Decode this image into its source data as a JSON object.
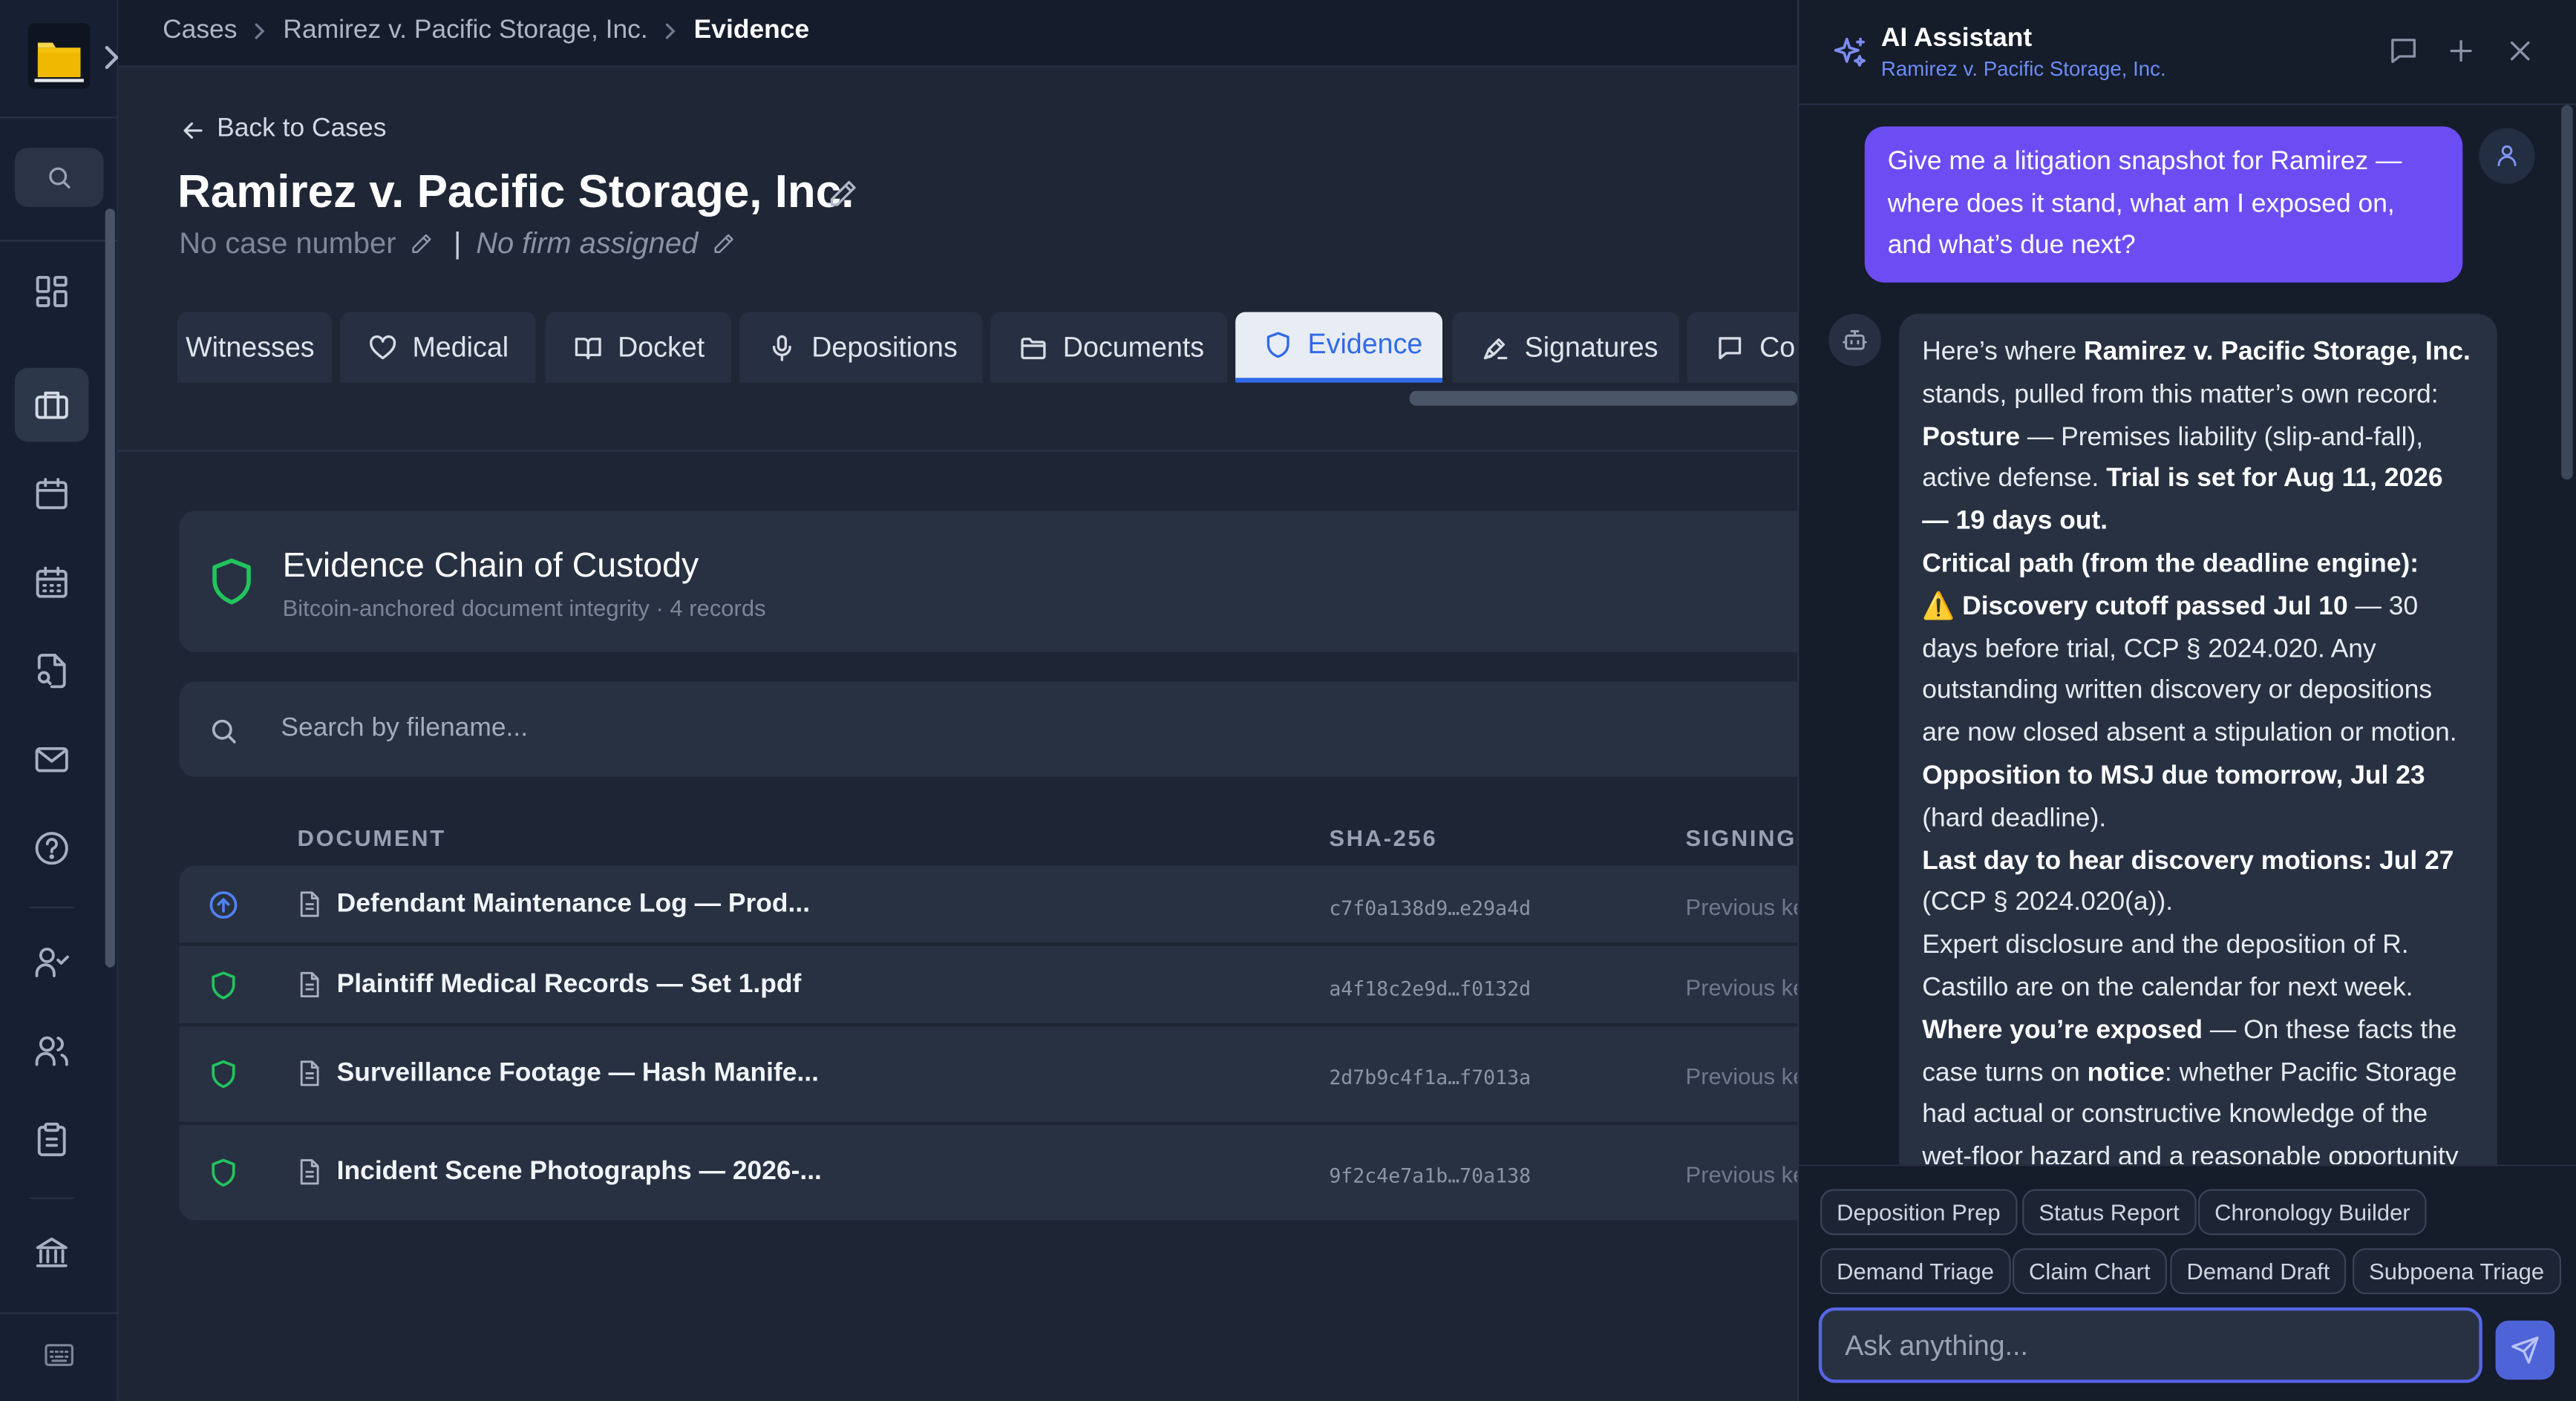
{
  "colors": {
    "accent": "#2f6bea",
    "verified_green": "#21c45d",
    "user_bubble": "#6c4df4",
    "ai_link": "#6b8df7",
    "background": "#1e2534"
  },
  "breadcrumb": {
    "items": [
      "Cases",
      "Ramirez v. Pacific Storage, Inc."
    ],
    "current": "Evidence"
  },
  "rail": {
    "icons": [
      "grid-icon",
      "briefcase-icon",
      "calendar-icon",
      "calendar-days-icon",
      "file-search-icon",
      "mail-icon",
      "help-icon",
      "user-check-icon",
      "users-icon",
      "clipboard-icon",
      "courthouse-icon",
      "keyboard-icon"
    ]
  },
  "case": {
    "back_label": "Back to Cases",
    "title": "Ramirez v. Pacific Storage, Inc.",
    "case_number": "No case number",
    "separator": "|",
    "firm": "No firm assigned"
  },
  "tabs": [
    {
      "label": "Witnesses",
      "icon": "none"
    },
    {
      "label": "Medical",
      "icon": "heart-icon"
    },
    {
      "label": "Docket",
      "icon": "book-icon"
    },
    {
      "label": "Depositions",
      "icon": "mic-icon"
    },
    {
      "label": "Documents",
      "icon": "folder-icon"
    },
    {
      "label": "Evidence",
      "icon": "shield-icon",
      "active": true
    },
    {
      "label": "Signatures",
      "icon": "signature-icon"
    },
    {
      "label": "Co",
      "icon": "message-icon"
    }
  ],
  "evidence": {
    "title": "Evidence Chain of Custody",
    "subtitle": "Bitcoin-anchored document integrity · 4 records",
    "search_placeholder": "Search by filename..."
  },
  "table": {
    "headers": {
      "document": "DOCUMENT",
      "sha": "SHA-256",
      "signing": "SIGNING K"
    },
    "rows": [
      {
        "status": "upload-pending-icon",
        "filename": "Defendant Maintenance Log — Prod...",
        "hash": "c7f0a138d9…e29a4d",
        "signer": "Previous key"
      },
      {
        "status": "verified-shield-icon",
        "filename": "Plaintiff Medical Records — Set 1.pdf",
        "hash": "a4f18c2e9d…f0132d",
        "signer": "Previous key"
      },
      {
        "status": "verified-shield-icon",
        "filename": "Surveillance Footage — Hash Manife...",
        "hash": "2d7b9c4f1a…f7013a",
        "signer": "Previous key"
      },
      {
        "status": "verified-shield-icon",
        "filename": "Incident Scene Photographs — 2026-...",
        "hash": "9f2c4e7a1b…70a138",
        "signer": "Previous key"
      }
    ]
  },
  "assistant": {
    "title": "AI Assistant",
    "subtitle": "Ramirez v. Pacific Storage, Inc.",
    "user_message": "Give me a litigation snapshot for Ramirez — where does it stand, what am I exposed on, and what’s due next?",
    "reply": {
      "intro_a": "Here’s where ",
      "intro_b": "Ramirez v. Pacific Storage, Inc.",
      "intro_c": " stands, pulled from this matter’s own record:",
      "posture_label": "Posture",
      "posture_text": " — Premises liability (slip-and-fall), active defense. ",
      "trial": "Trial is set for Aug 11, 2026 — 19 days out.",
      "critical_path": "Critical path (from the deadline engine):",
      "warn_icon": "⚠️",
      "cutoff": "Discovery cutoff passed Jul 10",
      "cutoff_text": " — 30 days before trial, CCP § 2024.020. Any outstanding written discovery or depositions are now closed absent a stipulation or motion.",
      "opposition": "Opposition to MSJ due tomorrow, Jul 23",
      "opposition_text": " (hard deadline).",
      "last_day": "Last day to hear discovery motions: Jul 27",
      "last_day_text": " (CCP § 2024.020(a)).",
      "expert": "Expert disclosure and the deposition of R. Castillo are on the calendar for next week.",
      "exposed": "Where you’re exposed",
      "exposed_text_a": " — On these facts the case turns on ",
      "notice": "notice",
      "exposed_text_b": ": whether Pacific Storage had actual or constructive knowledge of the wet-floor hazard and a reasonable opportunity"
    },
    "quick_actions": [
      "Deposition Prep",
      "Status Report",
      "Chronology Builder",
      "Demand Triage",
      "Claim Chart",
      "Demand Draft",
      "Subpoena Triage"
    ],
    "input_placeholder": "Ask anything..."
  }
}
